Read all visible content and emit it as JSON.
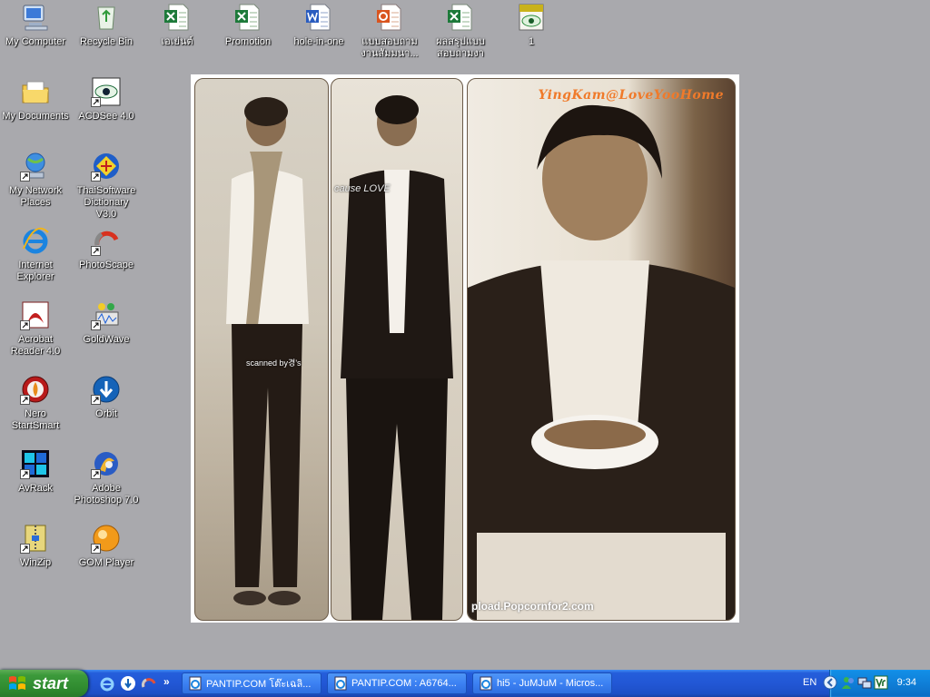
{
  "desktop": {
    "icons": [
      {
        "label": "My Computer",
        "icon": "my-computer-icon"
      },
      {
        "label": "Recycle Bin",
        "icon": "recycle-bin-icon"
      },
      {
        "label": "เอเย่นต์",
        "icon": "excel-file-icon"
      },
      {
        "label": "Promotion",
        "icon": "excel-file-icon"
      },
      {
        "label": "hole-in-one",
        "icon": "word-file-icon"
      },
      {
        "label": "แบบสอบถาม งานสัมมนา...",
        "icon": "powerpoint-file-icon"
      },
      {
        "label": "ผลสรุปแบบ สอบถามงา",
        "icon": "excel-file-icon"
      },
      {
        "label": "1",
        "icon": "jpg-file-icon"
      },
      {
        "label": "My Documents",
        "icon": "my-documents-icon"
      },
      {
        "label": "ACDSee 4.0",
        "icon": "acdsee-icon"
      },
      {
        "label": "My Network Places",
        "icon": "network-places-icon"
      },
      {
        "label": "ThaiSoftware Dictionary V3.0",
        "icon": "dictionary-icon"
      },
      {
        "label": "Internet Explorer",
        "icon": "internet-explorer-icon"
      },
      {
        "label": "PhotoScape",
        "icon": "photoscape-icon"
      },
      {
        "label": "Acrobat Reader 4.0",
        "icon": "acrobat-icon"
      },
      {
        "label": "GoldWave",
        "icon": "goldwave-icon"
      },
      {
        "label": "Nero StartSmart",
        "icon": "nero-icon"
      },
      {
        "label": "Orbit",
        "icon": "orbit-icon"
      },
      {
        "label": "AvRack",
        "icon": "avrack-icon"
      },
      {
        "label": "Adobe Photoshop 7.0",
        "icon": "photoshop-icon"
      },
      {
        "label": "WinZip",
        "icon": "winzip-icon"
      },
      {
        "label": "GOM Player",
        "icon": "gom-player-icon"
      }
    ],
    "wallpaper": {
      "watermark": "YingKam@LoveYooHome",
      "footer_text": "pload.Popcornfor2.com",
      "scan_text": "scanned by경's",
      "side_text": "cause LOVE"
    }
  },
  "taskbar": {
    "start_label": "start",
    "quick_launch": [
      "internet-explorer-icon",
      "orbit-icon",
      "photoscape-icon"
    ],
    "more": "»",
    "buttons": [
      {
        "label": "PANTIP.COM โต๊ะเฉลิ...",
        "icon": "ie-page-icon"
      },
      {
        "label": "PANTIP.COM : A6764...",
        "icon": "ie-page-icon"
      },
      {
        "label": "hi5 - JuMJuM - Micros...",
        "icon": "ie-page-icon"
      }
    ],
    "tray": {
      "language": "EN",
      "clock": "9:34",
      "icons": [
        "tray-expand-icon",
        "messenger-icon",
        "network-icon",
        "volume-icon",
        "antivirus-icon"
      ]
    }
  },
  "colors": {
    "desktop_bg": "#a9a9ad",
    "taskbar": "#245edb",
    "start_green": "#3c9a3b",
    "tray": "#0f7fd8",
    "watermark": "#f07a2a"
  }
}
